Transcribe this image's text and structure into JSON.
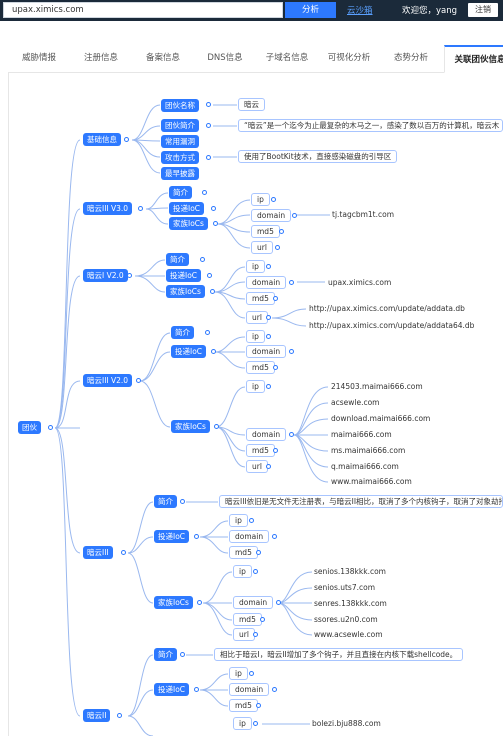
{
  "header": {
    "search_value": "upax.ximics.com",
    "search_button": "分析",
    "cloud_link": "云沙箱",
    "welcome": "欢迎您，yang",
    "logout": "注销"
  },
  "tabs": [
    "威胁情报",
    "注册信息",
    "备案信息",
    "DNS信息",
    "子域名信息",
    "可视化分析",
    "态势分析",
    "关联团伙信息"
  ],
  "graph": {
    "root": "团伙",
    "basic": {
      "label": "基础信息",
      "items": [
        {
          "label": "团伙名称",
          "value": "暗云"
        },
        {
          "label": "团伙简介",
          "value": "“暗云”是一个迄今为止最复杂的木马之一，感染了数以百万的计算机，暗云木"
        },
        {
          "label": "常用漏洞",
          "value": ""
        },
        {
          "label": "攻击方式",
          "value": "使用了BootKit技术，直接感染磁盘的引导区"
        },
        {
          "label": "最早披露",
          "value": ""
        }
      ]
    },
    "v30": {
      "label": "暗云III V3.0",
      "intro": "简介",
      "ioc": "投递IoC",
      "family": "家族IoCs",
      "ip": "ip",
      "domain": "domain",
      "md5": "md5",
      "url": "url",
      "domain_value": "tj.tagcbm1t.com"
    },
    "v20a": {
      "label": "暗云I V2.0",
      "intro": "简介",
      "ioc": "投递IoC",
      "family": "家族IoCs",
      "ip": "ip",
      "domain": "domain",
      "md5": "md5",
      "url": "url",
      "domain_value": "upax.ximics.com",
      "url_values": [
        "http://upax.ximics.com/update/addata.db",
        "http://upax.ximics.com/update/addata64.db"
      ]
    },
    "v20b": {
      "label": "暗云III V2.0",
      "intro": "简介",
      "ioc": "投递IoC",
      "family": "家族IoCs",
      "ip": "ip",
      "domain": "domain",
      "md5": "md5",
      "ip2": "ip",
      "domain2": "domain",
      "md52": "md5",
      "url2": "url",
      "domains": [
        "214503.maimai666.com",
        "acsewle.com",
        "download.maimai666.com",
        "maimai666.com",
        "ms.maimai666.com",
        "q.maimai666.com",
        "www.maimai666.com"
      ]
    },
    "a3": {
      "label": "暗云III",
      "intro": "简介",
      "intro_text": "暗云III依旧是无文件无注册表，与暗云II相比，取消了多个内核钩子，取消了对象劫持，",
      "ioc": "投递IoC",
      "family": "家族IoCs",
      "ip": "ip",
      "domain": "domain",
      "md5": "md5",
      "ip2": "ip",
      "domain2": "domain",
      "md52": "md5",
      "url2": "url",
      "domains": [
        "senios.138kkk.com",
        "senios.uts7.com",
        "senres.138kkk.com",
        "ssores.u2n0.com",
        "www.acsewle.com"
      ]
    },
    "a2": {
      "label": "暗云II",
      "intro": "简介",
      "intro_text": "相比于暗云I，暗云II增加了多个钩子，并且直接在内核下载shellcode。",
      "ioc": "投递IoC",
      "ip": "ip",
      "domain": "domain",
      "md5": "md5",
      "ip2": "ip",
      "domain_value": "bolezi.bju888.com"
    }
  },
  "colors": {
    "accent": "#2d79ff",
    "topbar": "#1b2a3a",
    "link": "#5aa0ff",
    "edge": "#9ab8ef"
  }
}
